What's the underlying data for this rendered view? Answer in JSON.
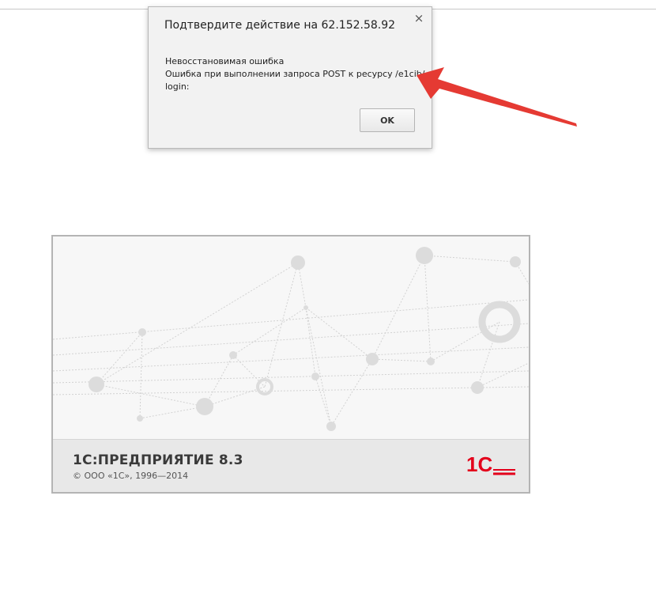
{
  "dialog": {
    "title": "Подтвердите действие на 62.152.58.92",
    "close_icon": "×",
    "message_lines": [
      "Невосстановимая ошибка",
      "Ошибка при выполнении запроса POST к ресурсу /e1cib/",
      "login:"
    ],
    "ok_label": "OK"
  },
  "splash": {
    "product_name": "1С:ПРЕДПРИЯТИЕ 8.3",
    "copyright": "© ООО «1С», 1996—2014",
    "logo_text": "1С"
  },
  "colors": {
    "arrow": "#e53a33",
    "logo": "#e3001b",
    "network": "#d0d0d0"
  }
}
